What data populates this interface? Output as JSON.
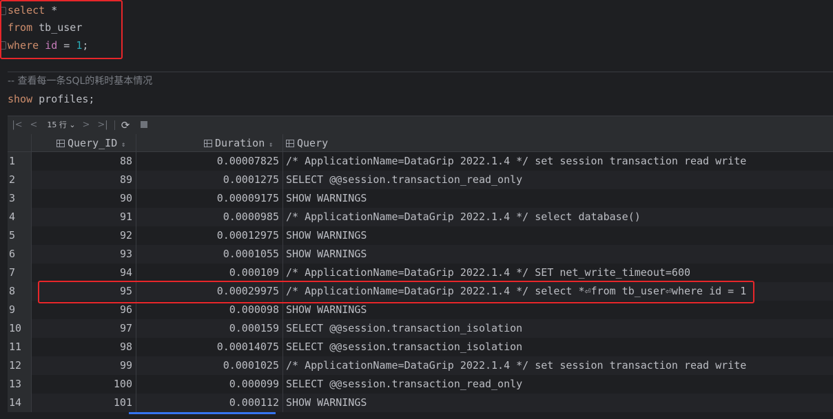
{
  "editor": {
    "line1": {
      "kw": "select",
      "rest": " *"
    },
    "line2": {
      "kw": "from",
      "rest": " tb_user"
    },
    "line3": {
      "kw": "where",
      "id": "id",
      "op": " = ",
      "num": "1",
      "end": ";"
    },
    "comment": "-- 查看每一条SQL的耗时基本情况",
    "line5": {
      "kw": "show",
      "rest": " profiles;"
    }
  },
  "toolbar": {
    "first_icon": "first-page-icon",
    "prev_icon": "prev-page-icon",
    "page_size": "15 行",
    "next_icon": "next-page-icon",
    "last_icon": "last-page-icon",
    "refresh_icon": "refresh-icon",
    "stop_icon": "stop-icon"
  },
  "grid": {
    "columns": [
      "Query_ID",
      "Duration",
      "Query"
    ],
    "rows": [
      {
        "n": "1",
        "id": "88",
        "dur": "0.00007825",
        "q": "/* ApplicationName=DataGrip 2022.1.4 */ set session transaction read write"
      },
      {
        "n": "2",
        "id": "89",
        "dur": "0.0001275",
        "q": "SELECT @@session.transaction_read_only"
      },
      {
        "n": "3",
        "id": "90",
        "dur": "0.00009175",
        "q": "SHOW WARNINGS"
      },
      {
        "n": "4",
        "id": "91",
        "dur": "0.0000985",
        "q": "/* ApplicationName=DataGrip 2022.1.4 */ select database()"
      },
      {
        "n": "5",
        "id": "92",
        "dur": "0.00012975",
        "q": "SHOW WARNINGS"
      },
      {
        "n": "6",
        "id": "93",
        "dur": "0.0001055",
        "q": "SHOW WARNINGS"
      },
      {
        "n": "7",
        "id": "94",
        "dur": "0.000109",
        "q": "/* ApplicationName=DataGrip 2022.1.4 */ SET net_write_timeout=600"
      },
      {
        "n": "8",
        "id": "95",
        "dur": "0.00029975",
        "q": "/* ApplicationName=DataGrip 2022.1.4 */ select *⏎from tb_user⏎where id = 1"
      },
      {
        "n": "9",
        "id": "96",
        "dur": "0.000098",
        "q": "SHOW WARNINGS"
      },
      {
        "n": "10",
        "id": "97",
        "dur": "0.000159",
        "q": "SELECT @@session.transaction_isolation"
      },
      {
        "n": "11",
        "id": "98",
        "dur": "0.00014075",
        "q": "SELECT @@session.transaction_isolation"
      },
      {
        "n": "12",
        "id": "99",
        "dur": "0.0001025",
        "q": "/* ApplicationName=DataGrip 2022.1.4 */ set session transaction read write"
      },
      {
        "n": "13",
        "id": "100",
        "dur": "0.000099",
        "q": "SELECT @@session.transaction_read_only"
      },
      {
        "n": "14",
        "id": "101",
        "dur": "0.000112",
        "q": "SHOW WARNINGS"
      }
    ]
  },
  "colors": {
    "highlight_box": "#e8262a",
    "background": "#1e1f22",
    "keyword": "#cf8e6d",
    "number": "#2aacb8"
  }
}
